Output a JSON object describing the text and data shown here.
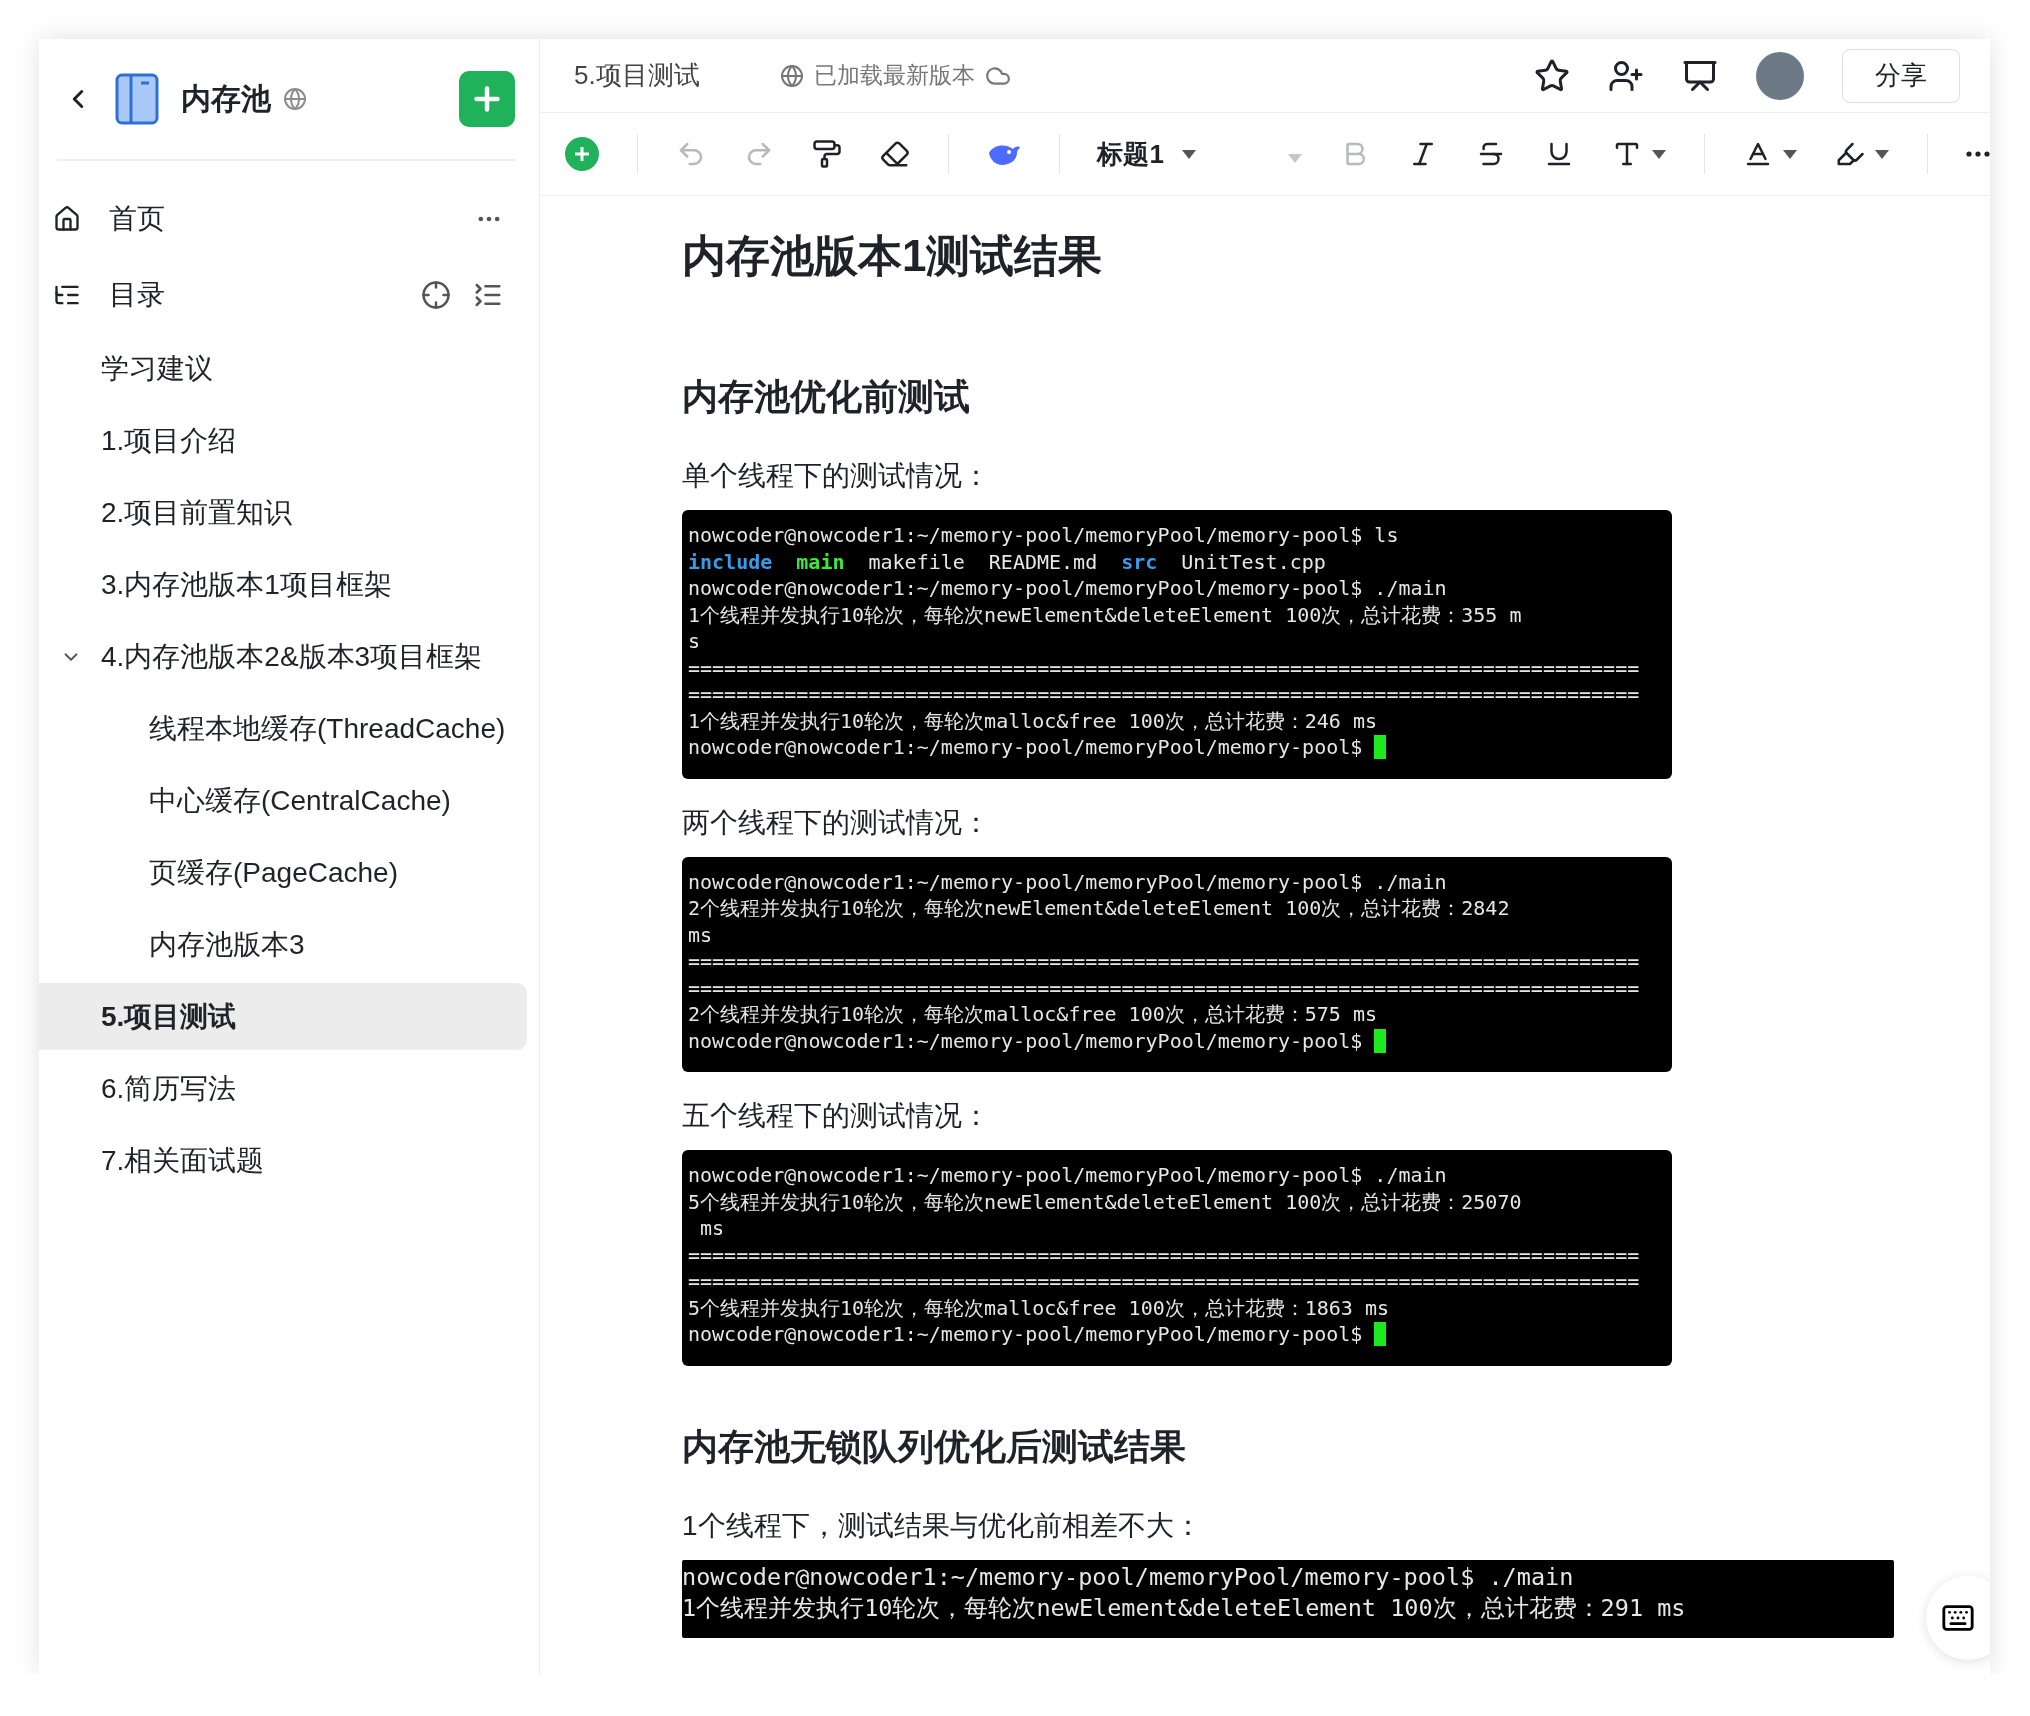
{
  "sidebar": {
    "title": "内存池",
    "nav": [
      {
        "kind": "home",
        "label": "首页"
      },
      {
        "kind": "toc",
        "label": "目录"
      }
    ],
    "tree": [
      {
        "label": "学习建议",
        "selected": false
      },
      {
        "label": "1.项目介绍",
        "selected": false
      },
      {
        "label": "2.项目前置知识",
        "selected": false
      },
      {
        "label": "3.内存池版本1项目框架",
        "selected": false
      },
      {
        "label": "4.内存池版本2&版本3项目框架",
        "selected": false,
        "expanded": true,
        "children": [
          {
            "label": "线程本地缓存(ThreadCache)",
            "selected": false
          },
          {
            "label": "中心缓存(CentralCache)",
            "selected": false
          },
          {
            "label": "页缓存(PageCache)",
            "selected": false
          },
          {
            "label": "内存池版本3",
            "selected": false
          }
        ]
      },
      {
        "label": "5.项目测试",
        "selected": true
      },
      {
        "label": "6.简历写法",
        "selected": false
      },
      {
        "label": "7.相关面试题",
        "selected": false
      }
    ]
  },
  "header": {
    "breadcrumb": "5.项目测试",
    "status": "已加载最新版本",
    "share": "分享"
  },
  "toolbar": {
    "tools": [
      {
        "kind": "insert"
      },
      {
        "kind": "sep"
      },
      {
        "kind": "undo",
        "disabled": true
      },
      {
        "kind": "redo",
        "disabled": true
      },
      {
        "kind": "painter"
      },
      {
        "kind": "eraser"
      },
      {
        "kind": "sep"
      },
      {
        "kind": "whale"
      },
      {
        "kind": "sep"
      },
      {
        "kind": "style",
        "label": "标题1"
      },
      {
        "kind": "bold",
        "disabled": true
      },
      {
        "kind": "italic"
      },
      {
        "kind": "strike"
      },
      {
        "kind": "underline"
      },
      {
        "kind": "fontsize"
      },
      {
        "kind": "sep"
      },
      {
        "kind": "color"
      },
      {
        "kind": "highlight"
      },
      {
        "kind": "sep"
      },
      {
        "kind": "more"
      }
    ]
  },
  "document": [
    {
      "kind": "h1",
      "text": "内存池版本1测试结果"
    },
    {
      "kind": "h2",
      "text": "内存池优化前测试"
    },
    {
      "kind": "p",
      "text": "单个线程下的测试情况："
    },
    {
      "kind": "terminal",
      "lines": [
        {
          "kind": "text",
          "text": "nowcoder@nowcoder1:~/memory-pool/memoryPool/memory-pool$ ls"
        },
        {
          "kind": "tokens",
          "tokens": [
            {
              "text": "include",
              "color": "#3a9be8",
              "bold": true
            },
            {
              "text": "main",
              "color": "#3be83b",
              "bold": true
            },
            {
              "text": "makefile",
              "color": "#e8e8e8",
              "bold": false
            },
            {
              "text": "README.md",
              "color": "#e8e8e8",
              "bold": false
            },
            {
              "text": "src",
              "color": "#3a9be8",
              "bold": true
            },
            {
              "text": "UnitTest.cpp",
              "color": "#e8e8e8",
              "bold": false
            }
          ]
        },
        {
          "kind": "text",
          "text": "nowcoder@nowcoder1:~/memory-pool/memoryPool/memory-pool$ ./main"
        },
        {
          "kind": "text",
          "text": "1个线程并发执行10轮次，每轮次newElement&deleteElement 100次，总计花费：355 m"
        },
        {
          "kind": "text",
          "text": "s"
        },
        {
          "kind": "text",
          "text": "==============================================================================="
        },
        {
          "kind": "text",
          "text": "==============================================================================="
        },
        {
          "kind": "text",
          "text": "1个线程并发执行10轮次，每轮次malloc&free 100次，总计花费：246 ms"
        },
        {
          "kind": "prompt",
          "text": "nowcoder@nowcoder1:~/memory-pool/memoryPool/memory-pool$ "
        }
      ]
    },
    {
      "kind": "p",
      "text": "两个线程下的测试情况："
    },
    {
      "kind": "terminal",
      "lines": [
        {
          "kind": "text",
          "text": "nowcoder@nowcoder1:~/memory-pool/memoryPool/memory-pool$ ./main"
        },
        {
          "kind": "text",
          "text": "2个线程并发执行10轮次，每轮次newElement&deleteElement 100次，总计花费：2842"
        },
        {
          "kind": "text",
          "text": "ms"
        },
        {
          "kind": "text",
          "text": "==============================================================================="
        },
        {
          "kind": "text",
          "text": "==============================================================================="
        },
        {
          "kind": "text",
          "text": "2个线程并发执行10轮次，每轮次malloc&free 100次，总计花费：575 ms"
        },
        {
          "kind": "prompt",
          "text": "nowcoder@nowcoder1:~/memory-pool/memoryPool/memory-pool$ "
        }
      ]
    },
    {
      "kind": "p",
      "text": "五个线程下的测试情况："
    },
    {
      "kind": "terminal",
      "lines": [
        {
          "kind": "text",
          "text": "nowcoder@nowcoder1:~/memory-pool/memoryPool/memory-pool$ ./main"
        },
        {
          "kind": "text",
          "text": "5个线程并发执行10轮次，每轮次newElement&deleteElement 100次，总计花费：25070"
        },
        {
          "kind": "text",
          "text": " ms"
        },
        {
          "kind": "text",
          "text": "==============================================================================="
        },
        {
          "kind": "text",
          "text": "==============================================================================="
        },
        {
          "kind": "text",
          "text": "5个线程并发执行10轮次，每轮次malloc&free 100次，总计花费：1863 ms"
        },
        {
          "kind": "prompt",
          "text": "nowcoder@nowcoder1:~/memory-pool/memoryPool/memory-pool$ "
        }
      ]
    },
    {
      "kind": "h2",
      "text": "内存池无锁队列优化后测试结果"
    },
    {
      "kind": "p",
      "text": "1个线程下，测试结果与优化前相差不大："
    },
    {
      "kind": "console",
      "lines": [
        {
          "kind": "text",
          "text": "nowcoder@nowcoder1:~/memory-pool/memoryPool/memory-pool$ ./main"
        },
        {
          "kind": "text",
          "text": "1个线程并发执行10轮次，每轮次newElement&deleteElement 100次，总计花费：291 ms"
        }
      ]
    }
  ]
}
